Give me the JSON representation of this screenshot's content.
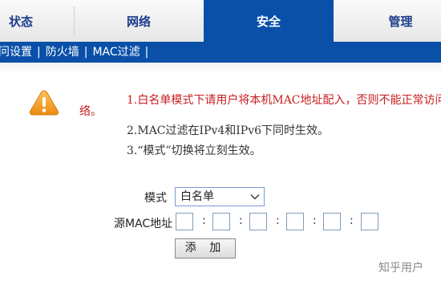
{
  "tabs": {
    "status": "状态",
    "network": "网络",
    "security": "安全",
    "manage": "管理"
  },
  "subnav": {
    "item1": "问设置",
    "item2": "防火墙",
    "item3": "MAC过滤",
    "sep": "|"
  },
  "notes": {
    "line1": "1.白名单模式下请用户将本机MAC地址配入，否则不能正常访问",
    "line1_cont": "络。",
    "line2": "2.MAC过滤在IPv4和IPv6下同时生效。",
    "line3": "3.“模式”切换将立刻生效。"
  },
  "form": {
    "mode_label": "模式",
    "mode_value": "白名单",
    "mac_label": "源MAC地址",
    "colon": ":",
    "add_button": "添 加"
  },
  "watermark": "知乎用户",
  "colors": {
    "accent": "#0a50a8",
    "warning_text": "#c81e1e",
    "warn_icon": "#f39a1e"
  }
}
